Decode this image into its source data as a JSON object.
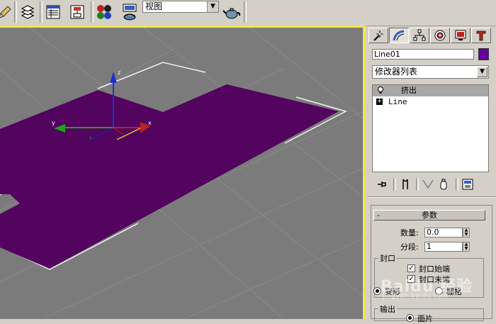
{
  "toolbar": {
    "view_select": "视图",
    "icons": [
      "pencil-icon",
      "layers-icon",
      "track-view-icon",
      "schematic-view-icon",
      "material-editor-icon",
      "render-setup-icon",
      "teapot-render-icon"
    ]
  },
  "viewport": {
    "object_color": "#52045f",
    "background": "#7b7b7b",
    "axis_labels": {
      "x": "x",
      "y": "y",
      "z": "z"
    }
  },
  "command_panel": {
    "tabs": [
      "create-tab",
      "modify-tab",
      "hierarchy-tab",
      "motion-tab",
      "display-tab",
      "utilities-tab"
    ],
    "active_tab": "modify-tab",
    "object_name": "Line01",
    "object_color": "#660099",
    "modifier_list": "修改器列表",
    "stack": [
      {
        "label": "挤出",
        "selected": true
      },
      {
        "label": "Line",
        "selected": false
      }
    ],
    "parameters": {
      "header": "参数",
      "collapse_symbol": "-",
      "amount_label": "数量:",
      "amount_value": "0.0",
      "segments_label": "分段:",
      "segments_value": "1",
      "capping_group": "封口",
      "cap_start": "封口始端",
      "cap_end": "封口末端",
      "morph": "变形",
      "grid": "栅格",
      "output_group": "输出",
      "patch": "面片"
    }
  },
  "watermark": {
    "main": "Baidu 经验",
    "sub": "jingyan.baidu.com"
  }
}
